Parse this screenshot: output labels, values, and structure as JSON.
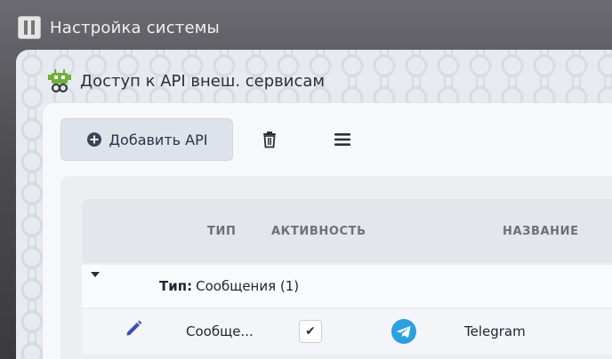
{
  "window": {
    "title": "Настройка системы"
  },
  "panel": {
    "title": "Доступ к API внеш. сервисам"
  },
  "toolbar": {
    "add_label": "Добавить API"
  },
  "table": {
    "headers": {
      "type": "ТИП",
      "active": "АКТИВНОСТЬ",
      "name": "НАЗВАНИЕ"
    },
    "group": {
      "label": "Тип:",
      "value": "Сообщения (1)"
    },
    "rows": [
      {
        "type": "Сообще...",
        "active": "✔",
        "name": "Telegram"
      }
    ]
  },
  "colors": {
    "accent": "#3d4fb8",
    "telegram": "#2aa0e0"
  },
  "icons": [
    "app-icon",
    "robot-icon",
    "plus-circle-icon",
    "trash-icon",
    "menu-icon",
    "caret-down-icon",
    "pencil-icon",
    "check-icon",
    "telegram-icon"
  ]
}
